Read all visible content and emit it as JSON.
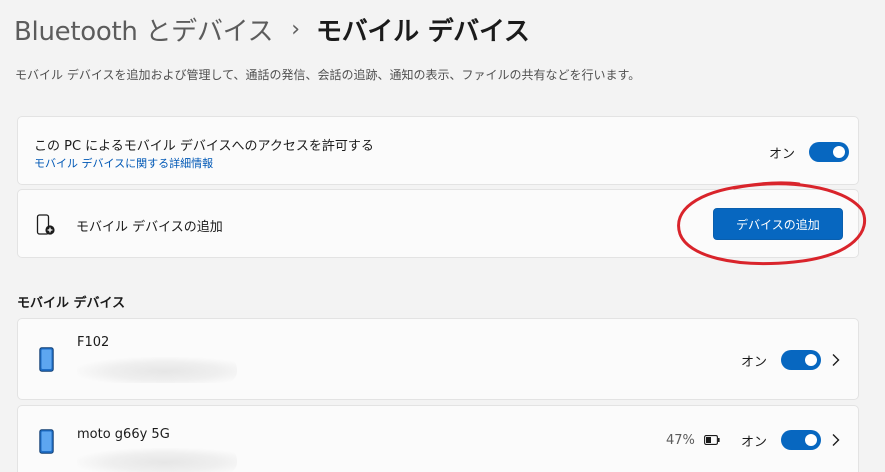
{
  "header": {
    "breadcrumb_parent": "Bluetooth とデバイス",
    "breadcrumb_separator": "›",
    "page_title": "モバイル デバイス"
  },
  "description": "モバイル デバイスを追加および管理して、通話の発信、会話の追跡、通知の表示、ファイルの共有などを行います。",
  "access": {
    "title": "この PC によるモバイル デバイスへのアクセスを許可する",
    "link": "モバイル デバイスに関する詳細情報",
    "toggle_label": "オン",
    "toggle_on": true
  },
  "add_device": {
    "label": "モバイル デバイスの追加",
    "button_label": "デバイスの追加",
    "icon": "phone-add-icon"
  },
  "section": {
    "title": "モバイル デバイス"
  },
  "devices": [
    {
      "name": "F102",
      "toggle_label": "オン",
      "toggle_on": true,
      "battery": null,
      "icon": "phone-icon"
    },
    {
      "name": "moto g66y 5G",
      "toggle_label": "オン",
      "toggle_on": true,
      "battery": "47%",
      "icon": "phone-icon"
    }
  ],
  "colors": {
    "accent": "#0767c0",
    "link": "#0058b6",
    "annotation": "#d9242b",
    "background": "#f3f3f3",
    "card": "#fbfbfb"
  }
}
